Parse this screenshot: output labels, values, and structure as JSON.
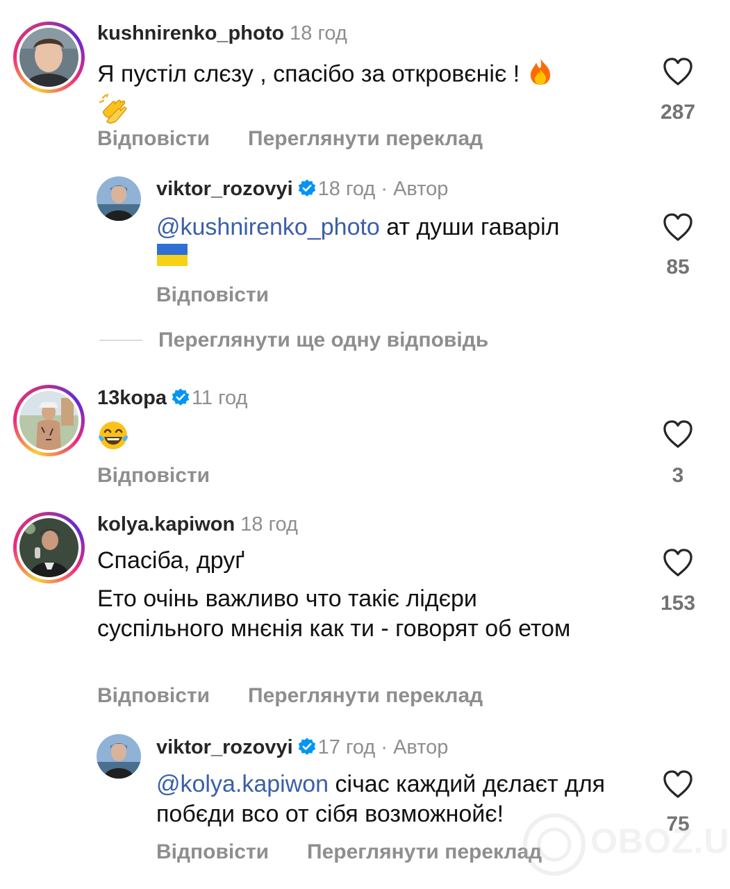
{
  "comments": [
    {
      "username": "kushnirenko_photo",
      "time": "18 год",
      "text": "Я пустіл слєзу , спасібо за откровєніє !",
      "likes": "287",
      "reply_label": "Відповісти",
      "translate_label": "Переглянути переклад"
    },
    {
      "username": "viktor_rozovyi",
      "time": "18 год",
      "author_label": "· Автор",
      "mention": "@kushnirenko_photo",
      "text": " ат души гаваріл",
      "likes": "85",
      "reply_label": "Відповісти"
    },
    {
      "username": "13kopa",
      "time": "11 год",
      "likes": "3",
      "reply_label": "Відповісти"
    },
    {
      "username": "kolya.kapiwon",
      "time": "18 год",
      "text_line1": "Спасіба, друґ",
      "text_line2": "Ето очінь важливо что такіє лідєри суспільного мнєнія как ти - говорят об етом",
      "likes": "153",
      "reply_label": "Відповісти",
      "translate_label": "Переглянути переклад"
    },
    {
      "username": "viktor_rozovyi",
      "time": "17 год",
      "author_label": "· Автор",
      "mention": "@kolya.kapiwon",
      "text": " січас каждий дєлаєт для побєди всо от сібя возможнойє!",
      "likes": "75",
      "reply_label": "Відповісти",
      "translate_label": "Переглянути переклад"
    }
  ],
  "view_more_replies": "Переглянути ще одну відповідь",
  "watermark": "OBOZ.UA",
  "icons": {
    "heart": "heart-outline-icon",
    "verified": "verified-badge-icon",
    "fire": "fire-emoji",
    "clap": "clapping-hands-emoji",
    "flag": "ukraine-flag-emoji",
    "laugh": "tears-of-joy-emoji"
  }
}
